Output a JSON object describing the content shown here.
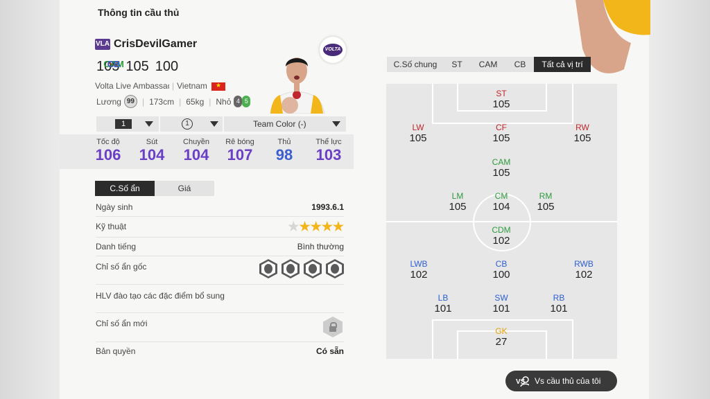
{
  "page": {
    "title": "Thông tin cầu thủ"
  },
  "player": {
    "badge": "VLA",
    "name": "CrisDevilGamer",
    "ratings": [
      {
        "pos": "ST",
        "val": "105",
        "color": "#c0262d"
      },
      {
        "pos": "CAM",
        "val": "105",
        "color": "#2e9a3e"
      },
      {
        "pos": "CB",
        "val": "100",
        "color": "#2c5fd0"
      }
    ],
    "team": "Volta Live Ambassador",
    "nation": "Vietnam",
    "salary_label": "Lương",
    "salary": "99",
    "height": "173cm",
    "weight": "65kg",
    "body": "Nhỏ",
    "left_foot": "4",
    "right_foot": "5",
    "club_logo_text": "VOLTA"
  },
  "selectors": {
    "level": "1",
    "upgrade": "1",
    "team_color": "Team Color (-)"
  },
  "stats": [
    {
      "label": "Tốc độ",
      "value": "106"
    },
    {
      "label": "Sút",
      "value": "104"
    },
    {
      "label": "Chuyền",
      "value": "104"
    },
    {
      "label": "Rê bóng",
      "value": "107"
    },
    {
      "label": "Thủ",
      "value": "98"
    },
    {
      "label": "Thể lực",
      "value": "103"
    }
  ],
  "detail_tabs": [
    "C.Số ẩn",
    "Giá"
  ],
  "details": {
    "birth_label": "Ngày sinh",
    "birth": "1993.6.1",
    "skill_label": "Kỹ thuật",
    "skill_stars": 4,
    "skill_max": 5,
    "reputation_label": "Danh tiếng",
    "reputation": "Bình thường",
    "traits_label": "Chỉ số ẩn gốc",
    "traits_icons": [
      "finesse-trait-icon",
      "power-trait-icon",
      "mind-trait-icon",
      "stamina-trait-icon"
    ],
    "coach_label": "HLV đào tạo các đặc điểm bổ sung",
    "new_traits_label": "Chỉ số ẩn mới",
    "license_label": "Bản quyền",
    "license": "Có sẵn"
  },
  "position_tabs": [
    "C.Số chung",
    "ST",
    "CAM",
    "CB",
    "Tất cả vị trí"
  ],
  "positions": {
    "ST": "105",
    "LW": "105",
    "CF": "105",
    "RW": "105",
    "CAM": "105",
    "LM": "105",
    "CM": "104",
    "RM": "105",
    "CDM": "102",
    "LWB": "102",
    "CB": "100",
    "RWB": "102",
    "LB": "101",
    "SW": "101",
    "RB": "101",
    "GK": "27"
  },
  "vs_button": {
    "icon_text": "VS",
    "label": "Vs cầu thủ của tôi"
  }
}
